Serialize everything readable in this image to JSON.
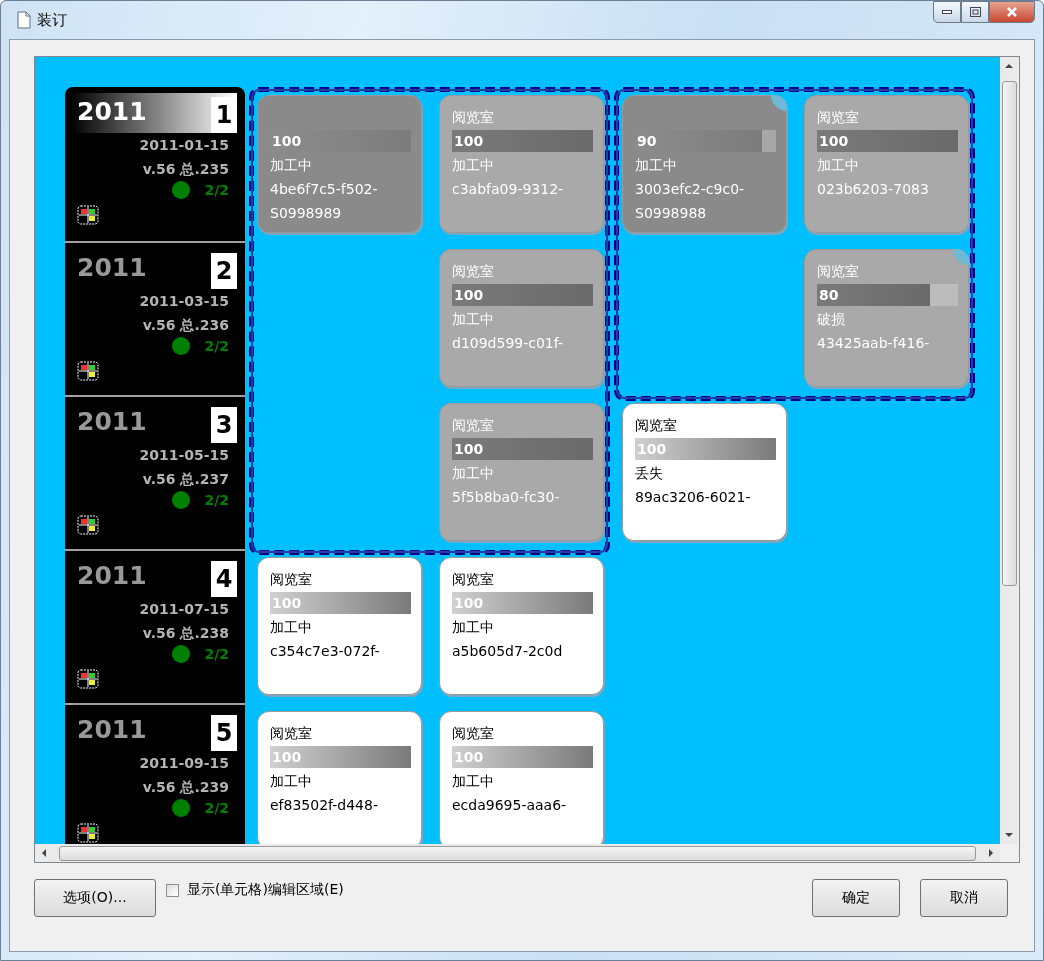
{
  "window": {
    "title": "装订"
  },
  "issues": [
    {
      "year": "2011",
      "number": "1",
      "selected": true,
      "date": "2011-01-15",
      "volume": "v.56 总.235",
      "count": "2/2",
      "color": "#008000",
      "cells": [
        {
          "kind": "volume",
          "corner_mark": false,
          "level": 1,
          "reading": "100",
          "status": "加工中",
          "id": "4be6f7c5-f502-",
          "barcode": "S0998989"
        },
        {
          "kind": "member",
          "corner_mark": false,
          "location": "阅览室",
          "level": 1,
          "reading": "100",
          "status": "加工中",
          "id": "c3abfa09-9312-"
        },
        {
          "kind": "volume",
          "corner_mark": true,
          "level": 0.9,
          "reading": "90",
          "status": "加工中",
          "id": "3003efc2-c9c0-",
          "barcode": "S0998988"
        },
        {
          "kind": "member",
          "corner_mark": false,
          "location": "阅览室",
          "level": 1,
          "reading": "100",
          "status": "加工中",
          "id": "023b6203-7083"
        }
      ]
    },
    {
      "year": "2011",
      "number": "2",
      "selected": false,
      "date": "2011-03-15",
      "volume": "v.56 总.236",
      "count": "2/2",
      "color": "#008000",
      "cells": [
        {
          "kind": "empty"
        },
        {
          "kind": "member",
          "corner_mark": false,
          "location": "阅览室",
          "level": 1,
          "reading": "100",
          "status": "加工中",
          "id": "d109d599-c01f-"
        },
        {
          "kind": "empty"
        },
        {
          "kind": "member",
          "corner_mark": true,
          "location": "阅览室",
          "level": 0.8,
          "reading": "80",
          "status": "破损",
          "id": "43425aab-f416-"
        }
      ]
    },
    {
      "year": "2011",
      "number": "3",
      "selected": false,
      "date": "2011-05-15",
      "volume": "v.56 总.237",
      "count": "2/2",
      "color": "#008000",
      "cells": [
        {
          "kind": "empty"
        },
        {
          "kind": "member",
          "corner_mark": false,
          "location": "阅览室",
          "level": 1,
          "reading": "100",
          "status": "加工中",
          "id": "5f5b8ba0-fc30-"
        },
        {
          "kind": "single",
          "corner_mark": false,
          "location": "阅览室",
          "level": 1,
          "reading": "100",
          "status": "丢失",
          "id": "89ac3206-6021-"
        }
      ]
    },
    {
      "year": "2011",
      "number": "4",
      "selected": false,
      "date": "2011-07-15",
      "volume": "v.56 总.238",
      "count": "2/2",
      "color": "#008000",
      "cells": [
        {
          "kind": "single",
          "corner_mark": false,
          "location": "阅览室",
          "level": 1,
          "reading": "100",
          "status": "加工中",
          "id": "c354c7e3-072f-"
        },
        {
          "kind": "single",
          "corner_mark": false,
          "location": "阅览室",
          "level": 1,
          "reading": "100",
          "status": "加工中",
          "id": "a5b605d7-2c0d"
        }
      ]
    },
    {
      "year": "2011",
      "number": "5",
      "selected": false,
      "date": "2011-09-15",
      "volume": "v.56 总.239",
      "count": "2/2",
      "color": "#008000",
      "cells": [
        {
          "kind": "single",
          "corner_mark": false,
          "location": "阅览室",
          "level": 1,
          "reading": "100",
          "status": "加工中",
          "id": "ef83502f-d448-"
        },
        {
          "kind": "single",
          "corner_mark": false,
          "location": "阅览室",
          "level": 1,
          "reading": "100",
          "status": "加工中",
          "id": "ecda9695-aaa6-"
        }
      ]
    }
  ],
  "options_button": "选项(O)...",
  "show_edit_area": {
    "label": "显示(单元格)编辑区域(E)",
    "checked": false
  },
  "buttons": [
    "确定",
    "取消"
  ]
}
